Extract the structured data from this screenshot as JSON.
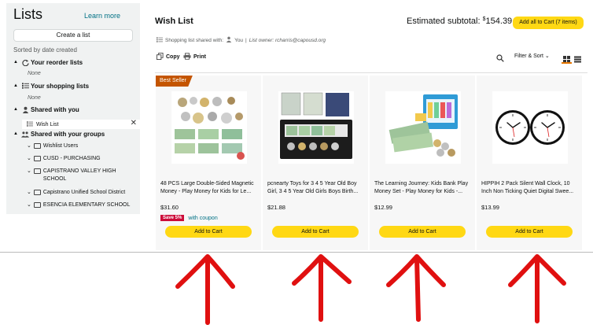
{
  "sidebar": {
    "title": "Lists",
    "learn_more": "Learn more",
    "create_list": "Create a list",
    "sorted_by": "Sorted by date created",
    "reorder_heading": "Your reorder lists",
    "reorder_none": "None",
    "shopping_heading": "Your shopping lists",
    "shopping_none": "None",
    "shared_heading": "Shared with you",
    "selected_list": "Wish List",
    "groups_heading": "Shared with your groups",
    "groups": [
      "Wishlist Users",
      "CUSD - PURCHASING",
      "CAPISTRANO VALLEY HIGH SCHOOL",
      "Capistrano Unified School District",
      "ESENCIA ELEMENTARY SCHOOL"
    ]
  },
  "header": {
    "title": "Wish List",
    "subtotal_label": "Estimated subtotal:",
    "subtotal_currency": "$",
    "subtotal_value": "154.39",
    "add_all": "Add all to Cart (7 items)",
    "shared_prefix": "Shopping list shared with:",
    "shared_you": "You",
    "list_owner": "List owner: rcharris@capousd.org",
    "copy": "Copy",
    "print": "Print",
    "filter_sort": "Filter & Sort"
  },
  "products": [
    {
      "badge": "Best Seller",
      "name": "48 PCS Large Double-Sided Magnetic Money - Play Money for Kids for Le...",
      "price": "$31.60",
      "coupon_tag": "Save 5%",
      "coupon_text": "with coupon",
      "add": "Add to Cart"
    },
    {
      "name": "pcnearty Toys for 3 4 5 Year Old Boy Girl, 3 4 5 Year Old Girls Boys Birth...",
      "price": "$21.88",
      "add": "Add to Cart"
    },
    {
      "name": "The Learning Journey: Kids Bank Play Money Set - Play Money for Kids -...",
      "price": "$12.99",
      "add": "Add to Cart"
    },
    {
      "name": "HIPPIH 2 Pack Silent Wall Clock, 10 Inch Non Ticking Quiet Digital Swee...",
      "price": "$13.99",
      "add": "Add to Cart"
    }
  ],
  "colors": {
    "accent_yellow": "#ffd814",
    "badge_orange": "#c45500",
    "coupon_red": "#cc0c39",
    "link_teal": "#007185",
    "annotation_red": "#e01010"
  }
}
